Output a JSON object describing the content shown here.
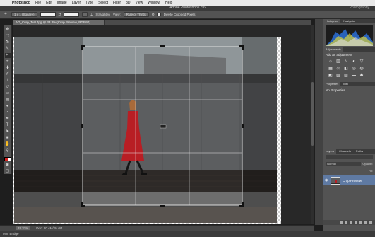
{
  "menubar": {
    "app": "Photoshop",
    "items": [
      "File",
      "Edit",
      "Image",
      "Layer",
      "Type",
      "Select",
      "Filter",
      "3D",
      "View",
      "Window",
      "Help"
    ]
  },
  "window": {
    "title": "Adobe Photoshop CS6",
    "workspace": "Photography"
  },
  "options": {
    "ratio": "1 x 1 (Square)",
    "straighten": "Straighten",
    "view": "View:",
    "view_value": "Rule of Thirds",
    "delete_cropped": "Delete Cropped Pixels"
  },
  "document": {
    "tab_title": "AG_Crop_TutLJpg @ 33.3% (Crop Preview, RGB/8*)"
  },
  "status": {
    "zoom": "33.33%",
    "doc_size": "Doc: 20.4M/20.4M"
  },
  "bottom": {
    "label": "Mini Bridge"
  },
  "panels": {
    "histogram_tab": "Histogram",
    "navigator_tab": "Navigator",
    "adjustments_tab": "Adjustments",
    "adjustments_title": "Add an adjustment",
    "properties_tab": "Properties",
    "info_tab": "Info",
    "properties_text": "No Properties",
    "layers_tab": "Layers",
    "channels_tab": "Channels",
    "paths_tab": "Paths",
    "blend_mode": "Normal",
    "opacity": "Opacity:",
    "fill": "Fill:",
    "layer_name": "Crop Preview"
  },
  "colors": {
    "foreground": "#d4201e",
    "background": "#ffffff",
    "dress": "#b81e24"
  }
}
